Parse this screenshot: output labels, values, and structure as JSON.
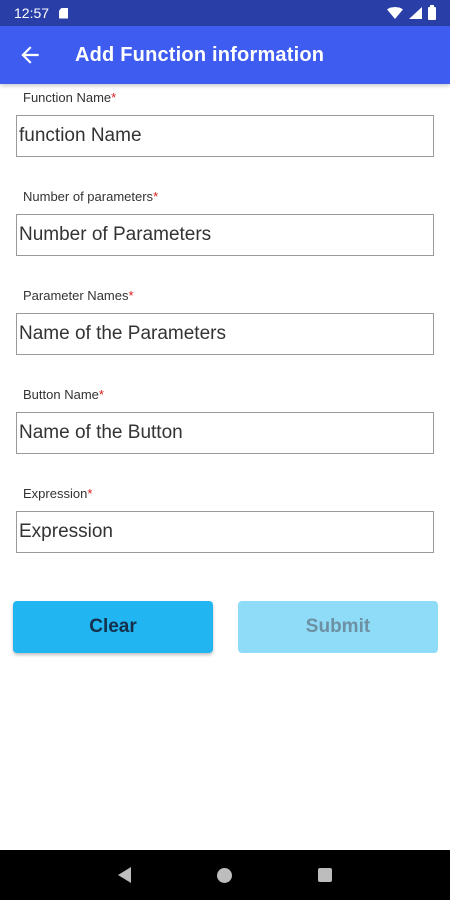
{
  "status_bar": {
    "time": "12:57",
    "icons": [
      "sd-card-icon",
      "wifi-icon",
      "signal-icon",
      "battery-icon"
    ]
  },
  "app_bar": {
    "title": "Add Function information",
    "back_icon": "arrow-left-icon",
    "color": "#3f5cf0"
  },
  "form": {
    "fields": [
      {
        "label": "Function Name",
        "required_mark": "*",
        "placeholder": "function Name"
      },
      {
        "label": "Number of parameters",
        "required_mark": "*",
        "placeholder": "Number of Parameters"
      },
      {
        "label": "Parameter Names",
        "required_mark": "*",
        "placeholder": "Name of the Parameters"
      },
      {
        "label": "Button Name",
        "required_mark": "*",
        "placeholder": "Name of the Button"
      },
      {
        "label": "Expression",
        "required_mark": "*",
        "placeholder": "Expression"
      }
    ]
  },
  "buttons": {
    "clear_label": "Clear",
    "submit_label": "Submit",
    "clear_color": "#21b5f2",
    "submit_color": "#8fdcf8"
  },
  "nav_bar": {
    "icons": [
      "nav-back-icon",
      "nav-home-icon",
      "nav-recents-icon"
    ]
  }
}
